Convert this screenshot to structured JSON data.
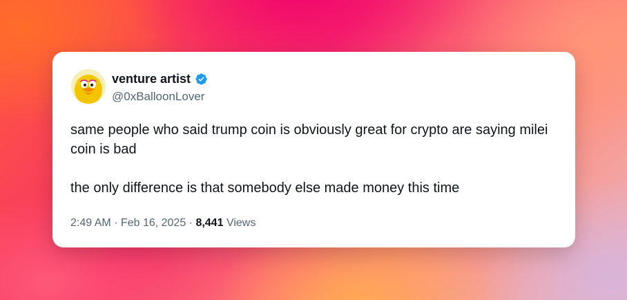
{
  "tweet": {
    "author_name": "venture artist",
    "author_handle": "@0xBalloonLover",
    "verified": true,
    "text_paragraphs": [
      "same people who said trump coin is obviously great for crypto are saying milei coin is bad",
      "the only difference is that somebody else made money this time"
    ],
    "time": "2:49 AM",
    "separator": " · ",
    "date": "Feb 16, 2025",
    "views_count": "8,441",
    "views_label": "Views"
  },
  "icons": {
    "avatar": "big-bird-avatar-icon",
    "verified": "verified-badge-icon"
  },
  "colors": {
    "verified_badge": "#1d9bf0",
    "text_primary": "#0f1419",
    "text_secondary": "#536471",
    "card_background": "#ffffff"
  }
}
